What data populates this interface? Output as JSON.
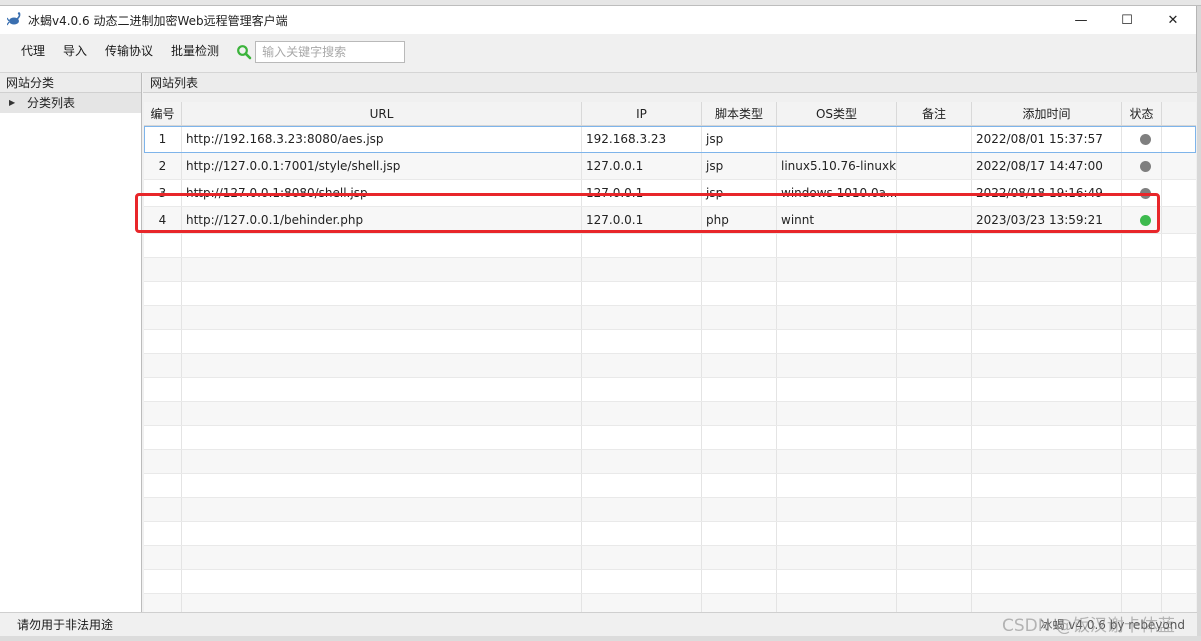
{
  "window": {
    "title": "冰蝎v4.0.6 动态二进制加密Web远程管理客户端",
    "minimize": "—",
    "maximize": "☐",
    "close": "✕"
  },
  "menu": {
    "items": [
      "代理",
      "导入",
      "传输协议",
      "批量检测"
    ],
    "search_placeholder": "输入关键字搜索"
  },
  "left_panel": {
    "header": "网站分类",
    "tree_item": "分类列表",
    "tree_arrow": "▶"
  },
  "right_panel": {
    "header": "网站列表"
  },
  "table": {
    "columns": [
      "编号",
      "URL",
      "IP",
      "脚本类型",
      "OS类型",
      "备注",
      "添加时间",
      "状态"
    ],
    "rows": [
      {
        "id": "1",
        "url": "http://192.168.3.23:8080/aes.jsp",
        "ip": "192.168.3.23",
        "script": "jsp",
        "os": "",
        "note": "",
        "time": "2022/08/01 15:37:57",
        "status": "offline"
      },
      {
        "id": "2",
        "url": "http://127.0.0.1:7001/style/shell.jsp",
        "ip": "127.0.0.1",
        "script": "jsp",
        "os": "linux5.10.76-linuxk...",
        "note": "",
        "time": "2022/08/17 14:47:00",
        "status": "offline"
      },
      {
        "id": "3",
        "url": "http://127.0.0.1:8080/shell.jsp",
        "ip": "127.0.0.1",
        "script": "jsp",
        "os": "windows 1010.0a...",
        "note": "",
        "time": "2022/08/18 19:16:49",
        "status": "offline"
      },
      {
        "id": "4",
        "url": "http://127.0.0.1/behinder.php",
        "ip": "127.0.0.1",
        "script": "php",
        "os": "winnt",
        "note": "",
        "time": "2023/03/23 13:59:21",
        "status": "online"
      }
    ],
    "status_colors": {
      "online": "#3dba4e",
      "offline": "#7f7f7f"
    }
  },
  "statusbar": {
    "left": "请勿用于非法用途",
    "right": "冰蝎 v4.0.6 by rebeyond"
  },
  "watermark": "CSDN @饭汉谢卡体蓝",
  "colors": {
    "highlight": "#e8262a",
    "selection": "#7eb4ea",
    "search_icon": "#3bb33b"
  }
}
